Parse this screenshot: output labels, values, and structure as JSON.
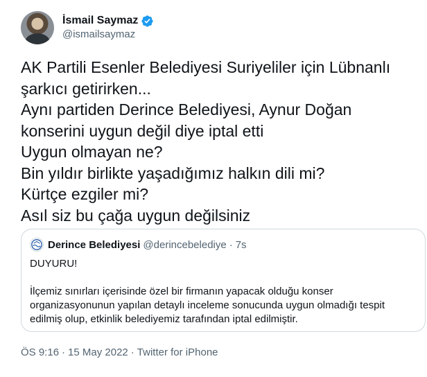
{
  "author": {
    "display_name": "İsmail Saymaz",
    "handle": "@ismailsaymaz",
    "verified": true,
    "verified_color": "#1d9bf0",
    "avatar_icon": "profile-photo"
  },
  "tweet": {
    "lines": [
      "AK Partili Esenler Belediyesi Suriyeliler için Lübnanlı",
      "şarkıcı getirirken...",
      "Aynı partiden Derince Belediyesi, Aynur Doğan",
      "konserini uygun değil diye iptal etti",
      "Uygun olmayan ne?",
      "Bin yıldır birlikte yaşadığımız halkın dili mi?",
      "Kürtçe ezgiler mi?",
      "Asıl siz bu çağa uygun değilsiniz"
    ]
  },
  "quoted": {
    "display_name": "Derince Belediyesi",
    "handle": "@derincebelediye",
    "separator": "·",
    "time": "7s",
    "avatar_icon": "municipality-logo",
    "heading": "DUYURU!",
    "body_lines": [
      "İlçemiz sınırları içerisinde özel bir firmanın yapacak olduğu konser",
      "organizasyonunun yapılan detaylı inceleme sonucunda uygun olmadığı tespit",
      "edilmiş olup, etkinlik belediyemiz tarafından iptal edilmiştir."
    ]
  },
  "footer": {
    "time": "ÖS 9:16",
    "sep1": "·",
    "date": "15 May 2022",
    "sep2": "·",
    "source": "Twitter for iPhone"
  },
  "colors": {
    "text": "#0f1419",
    "secondary": "#536471",
    "border": "#cfd9de"
  }
}
